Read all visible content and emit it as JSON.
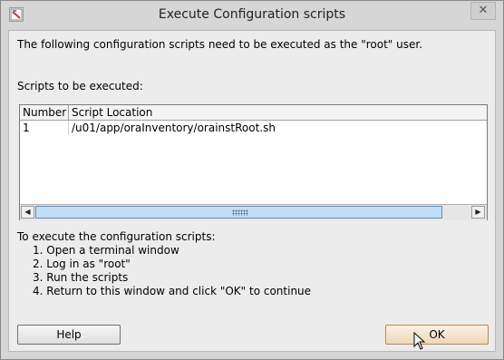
{
  "window": {
    "title": "Execute Configuration scripts",
    "close_glyph": "✕"
  },
  "intro_text": "The following configuration scripts need to be executed as the \"root\" user.",
  "scripts_label": "Scripts to be executed:",
  "table": {
    "columns": [
      "Number",
      "Script Location"
    ],
    "rows": [
      {
        "number": "1",
        "location": "/u01/app/oraInventory/orainstRoot.sh"
      }
    ]
  },
  "instructions": {
    "heading": "To execute the configuration scripts:",
    "steps": [
      "1. Open a terminal window",
      "2. Log in as \"root\"",
      "3. Run the scripts",
      "4. Return to this window and click \"OK\" to continue"
    ]
  },
  "buttons": {
    "help": "Help",
    "ok": "OK"
  },
  "scrollbar": {
    "left_arrow": "◀",
    "right_arrow": "▶"
  },
  "icons": {
    "app": "configuration-scripts-icon",
    "close": "close-icon",
    "left": "scroll-left-icon",
    "right": "scroll-right-icon",
    "cursor": "mouse-pointer-icon"
  }
}
